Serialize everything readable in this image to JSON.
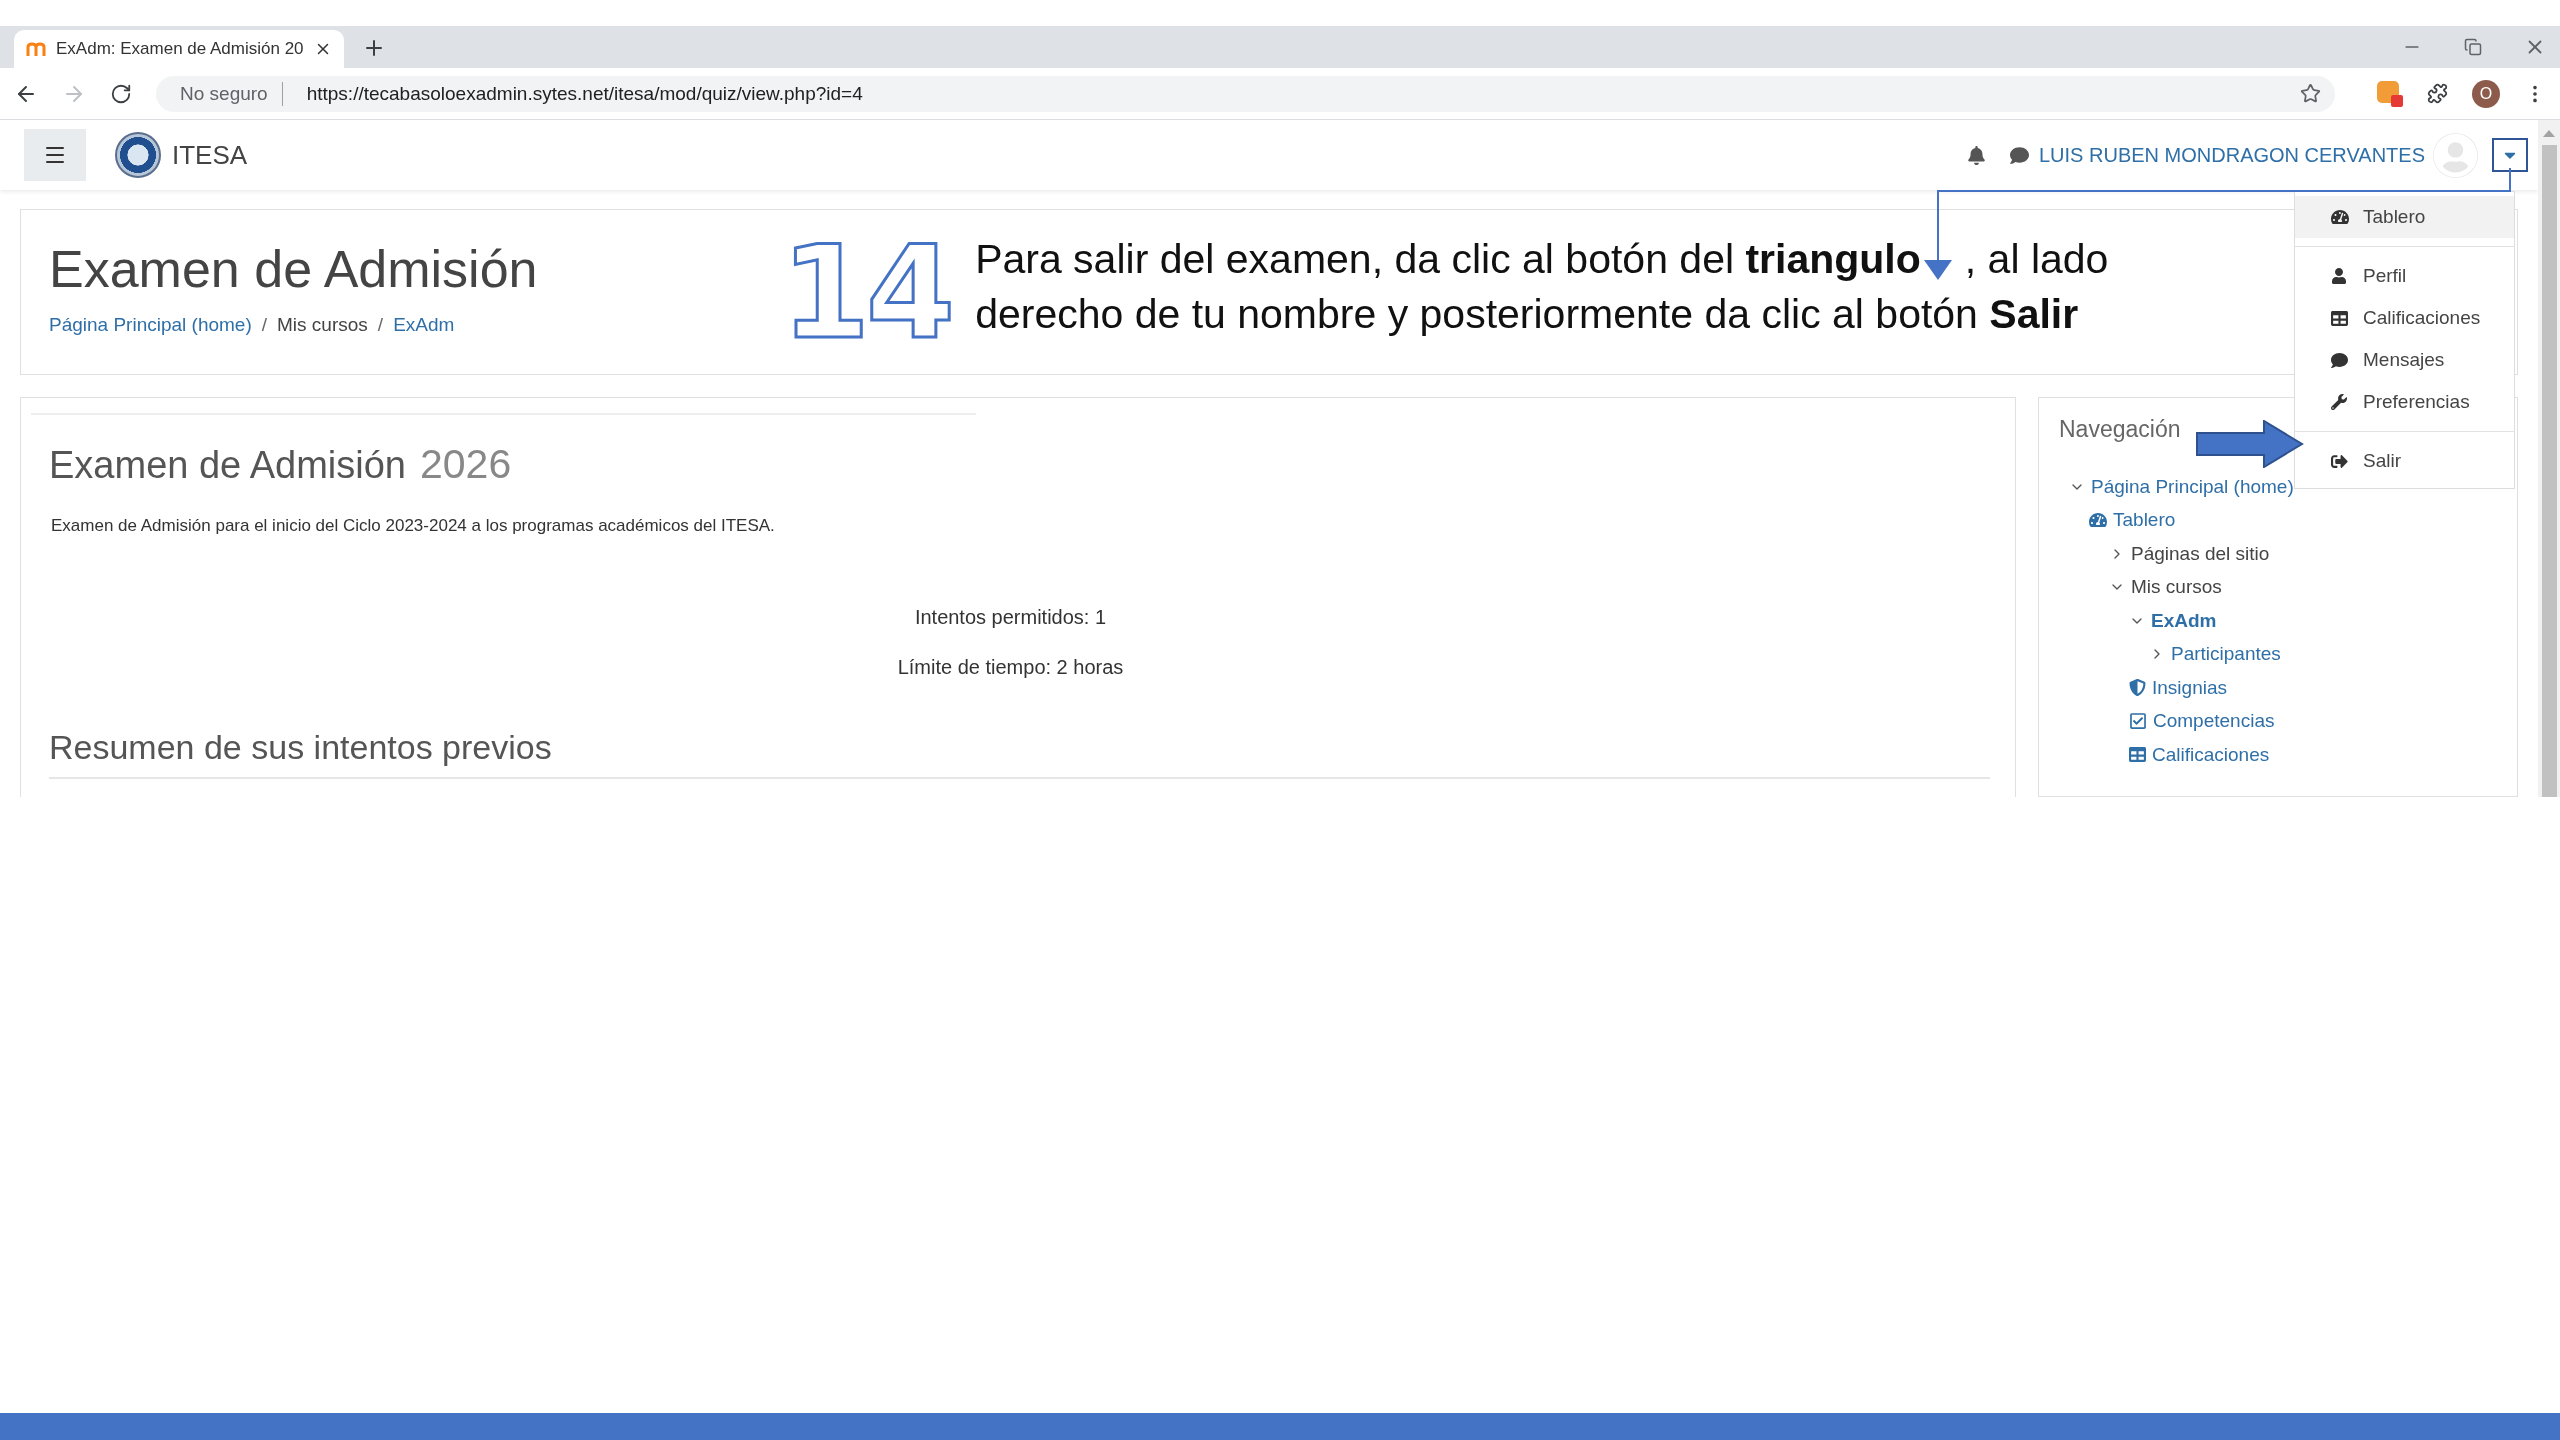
{
  "browser": {
    "tab": {
      "title": "ExAdm: Examen de Admisión 20",
      "selected": true
    },
    "security": "No seguro",
    "url": "https://tecabasoloexadmin.sytes.net/itesa/mod/quiz/view.php?id=4",
    "profile_initial": "O"
  },
  "navbar": {
    "site_name": "ITESA",
    "user_name": "LUIS RUBEN MONDRAGON CERVANTES"
  },
  "header": {
    "title": "Examen de Admisión",
    "separator": "/",
    "breadcrumb": [
      {
        "label": "Página Principal (home)",
        "link": true
      },
      {
        "label": "Mis cursos",
        "link": false
      },
      {
        "label": "ExAdm",
        "link": true
      }
    ]
  },
  "annotation": {
    "step": "14",
    "text_before": "Para salir del examen, da clic al botón del **triangulo**",
    "text_after": ", al lado derecho de tu nombre y posteriormente da clic al botón **Salir**"
  },
  "quiz": {
    "title": "Examen de Admisión",
    "year": "2026",
    "description": "Examen de Admisión para el inicio del Ciclo 2023-2024 a los programas académicos del ITESA.",
    "info": [
      "Intentos permitidos: 1",
      "Límite de tiempo: 2 horas"
    ],
    "section_heading": "Resumen de sus intentos previos"
  },
  "navigation": {
    "title": "Navegación",
    "tree": [
      {
        "label": "Página Principal (home)",
        "kind": "branch",
        "expanded": true,
        "link": true,
        "current": false,
        "children": [
          {
            "label": "Tablero",
            "kind": "gauge",
            "link": true,
            "current": false,
            "children": [
              {
                "label": "Páginas del sitio",
                "kind": "branch",
                "expanded": false,
                "link": false,
                "current": false
              },
              {
                "label": "Mis cursos",
                "kind": "branch",
                "expanded": true,
                "link": false,
                "current": false,
                "children": [
                  {
                    "label": "ExAdm",
                    "kind": "branch",
                    "expanded": true,
                    "link": true,
                    "current": true,
                    "children": [
                      {
                        "label": "Participantes",
                        "kind": "branch",
                        "expanded": false,
                        "link": true,
                        "current": false
                      }
                    ]
                  },
                  {
                    "label": "Insignias",
                    "kind": "shield",
                    "link": true,
                    "current": false
                  },
                  {
                    "label": "Competencias",
                    "kind": "checkbox",
                    "link": true,
                    "current": false
                  },
                  {
                    "label": "Calificaciones",
                    "kind": "grid",
                    "link": true,
                    "current": false
                  }
                ]
              }
            ]
          }
        ]
      }
    ]
  },
  "user_menu": [
    {
      "kind": "gauge",
      "label": "Tablero",
      "selected": true
    },
    {
      "kind": "divider"
    },
    {
      "kind": "user",
      "label": "Perfil",
      "selected": false
    },
    {
      "kind": "grid",
      "label": "Calificaciones",
      "selected": false
    },
    {
      "kind": "chat",
      "label": "Mensajes",
      "selected": false
    },
    {
      "kind": "wrench",
      "label": "Preferencias",
      "selected": false
    },
    {
      "kind": "divider"
    },
    {
      "kind": "exit",
      "label": "Salir",
      "selected": false
    }
  ]
}
